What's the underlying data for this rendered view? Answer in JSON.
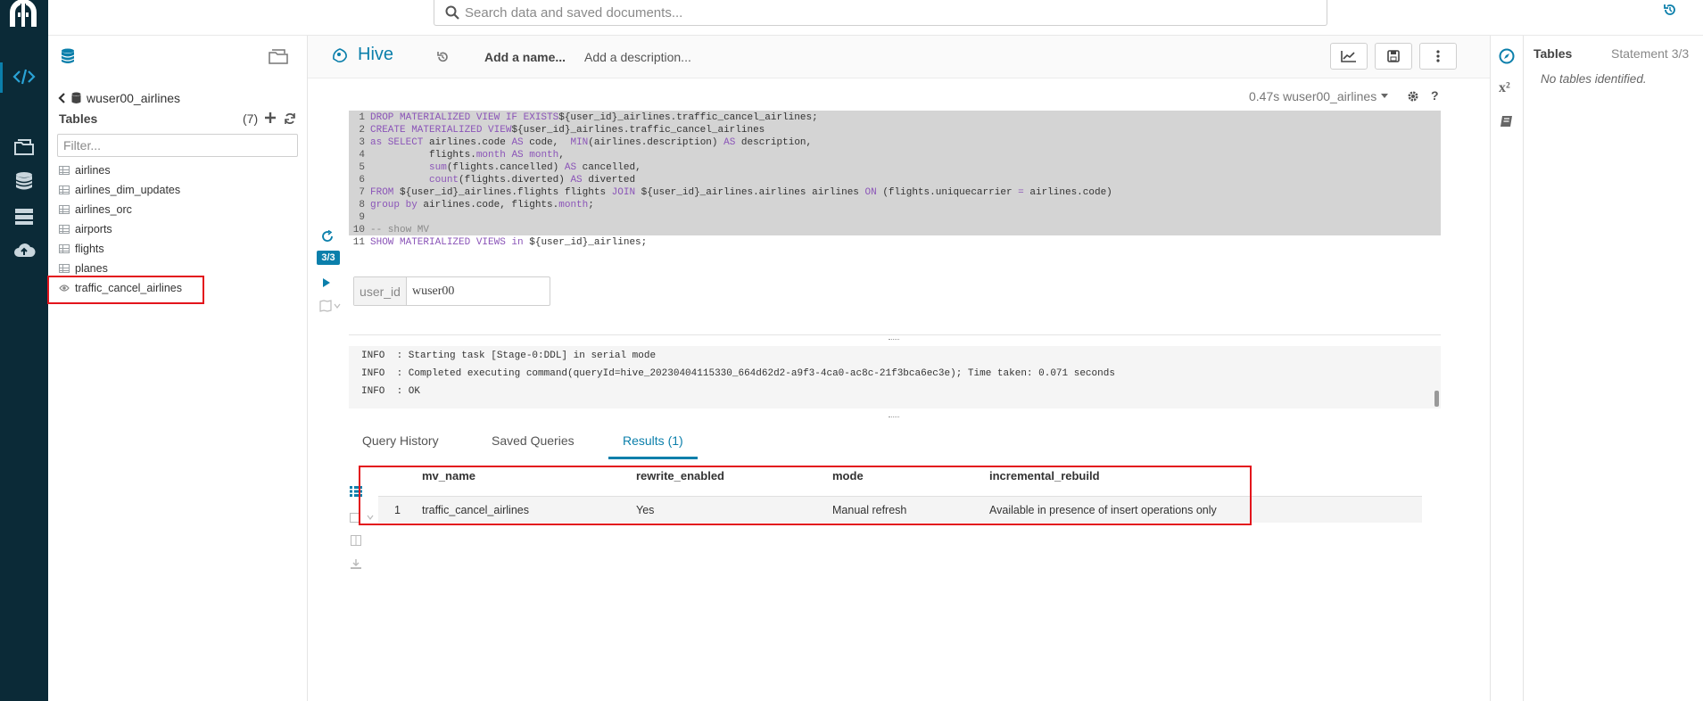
{
  "search": {
    "placeholder": "Search data and saved documents..."
  },
  "assist": {
    "database": "wuser00_airlines",
    "tables_label": "Tables",
    "tables_count": "(7)",
    "filter_placeholder": "Filter...",
    "tables": [
      "airlines",
      "airlines_dim_updates",
      "airlines_orc",
      "airports",
      "flights",
      "planes",
      "traffic_cancel_airlines"
    ]
  },
  "editor": {
    "engine": "Hive",
    "name_placeholder": "Add a name...",
    "description_placeholder": "Add a description...",
    "exec_info": "0.47s wuser00_airlines",
    "statement_badge": "3/3",
    "line_numbers": [
      "1",
      "2",
      "3",
      "4",
      "5",
      "6",
      "7",
      "8",
      "9",
      "10",
      "11"
    ],
    "param_label": "user_id",
    "param_value": "wuser00"
  },
  "log": [
    "INFO  : Starting task [Stage-0:DDL] in serial mode",
    "INFO  : Completed executing command(queryId=hive_20230404115330_664d62d2-a9f3-4ca0-ac8c-21f3bca6ec3e); Time taken: 0.071 seconds",
    "INFO  : OK"
  ],
  "tabs": {
    "history": "Query History",
    "saved": "Saved Queries",
    "results": "Results (1)"
  },
  "results": {
    "headers": [
      "mv_name",
      "rewrite_enabled",
      "mode",
      "incremental_rebuild"
    ],
    "rows": [
      {
        "index": "1",
        "mv_name": "traffic_cancel_airlines",
        "rewrite_enabled": "Yes",
        "mode": "Manual refresh",
        "incremental_rebuild": "Available in presence of insert operations only"
      }
    ]
  },
  "right_panel": {
    "tables_label": "Tables",
    "statement": "Statement 3/3",
    "empty": "No tables identified."
  },
  "colors": {
    "rail": "#0b2a37",
    "accent": "#0b7fab",
    "highlight_box": "#e3141c"
  }
}
